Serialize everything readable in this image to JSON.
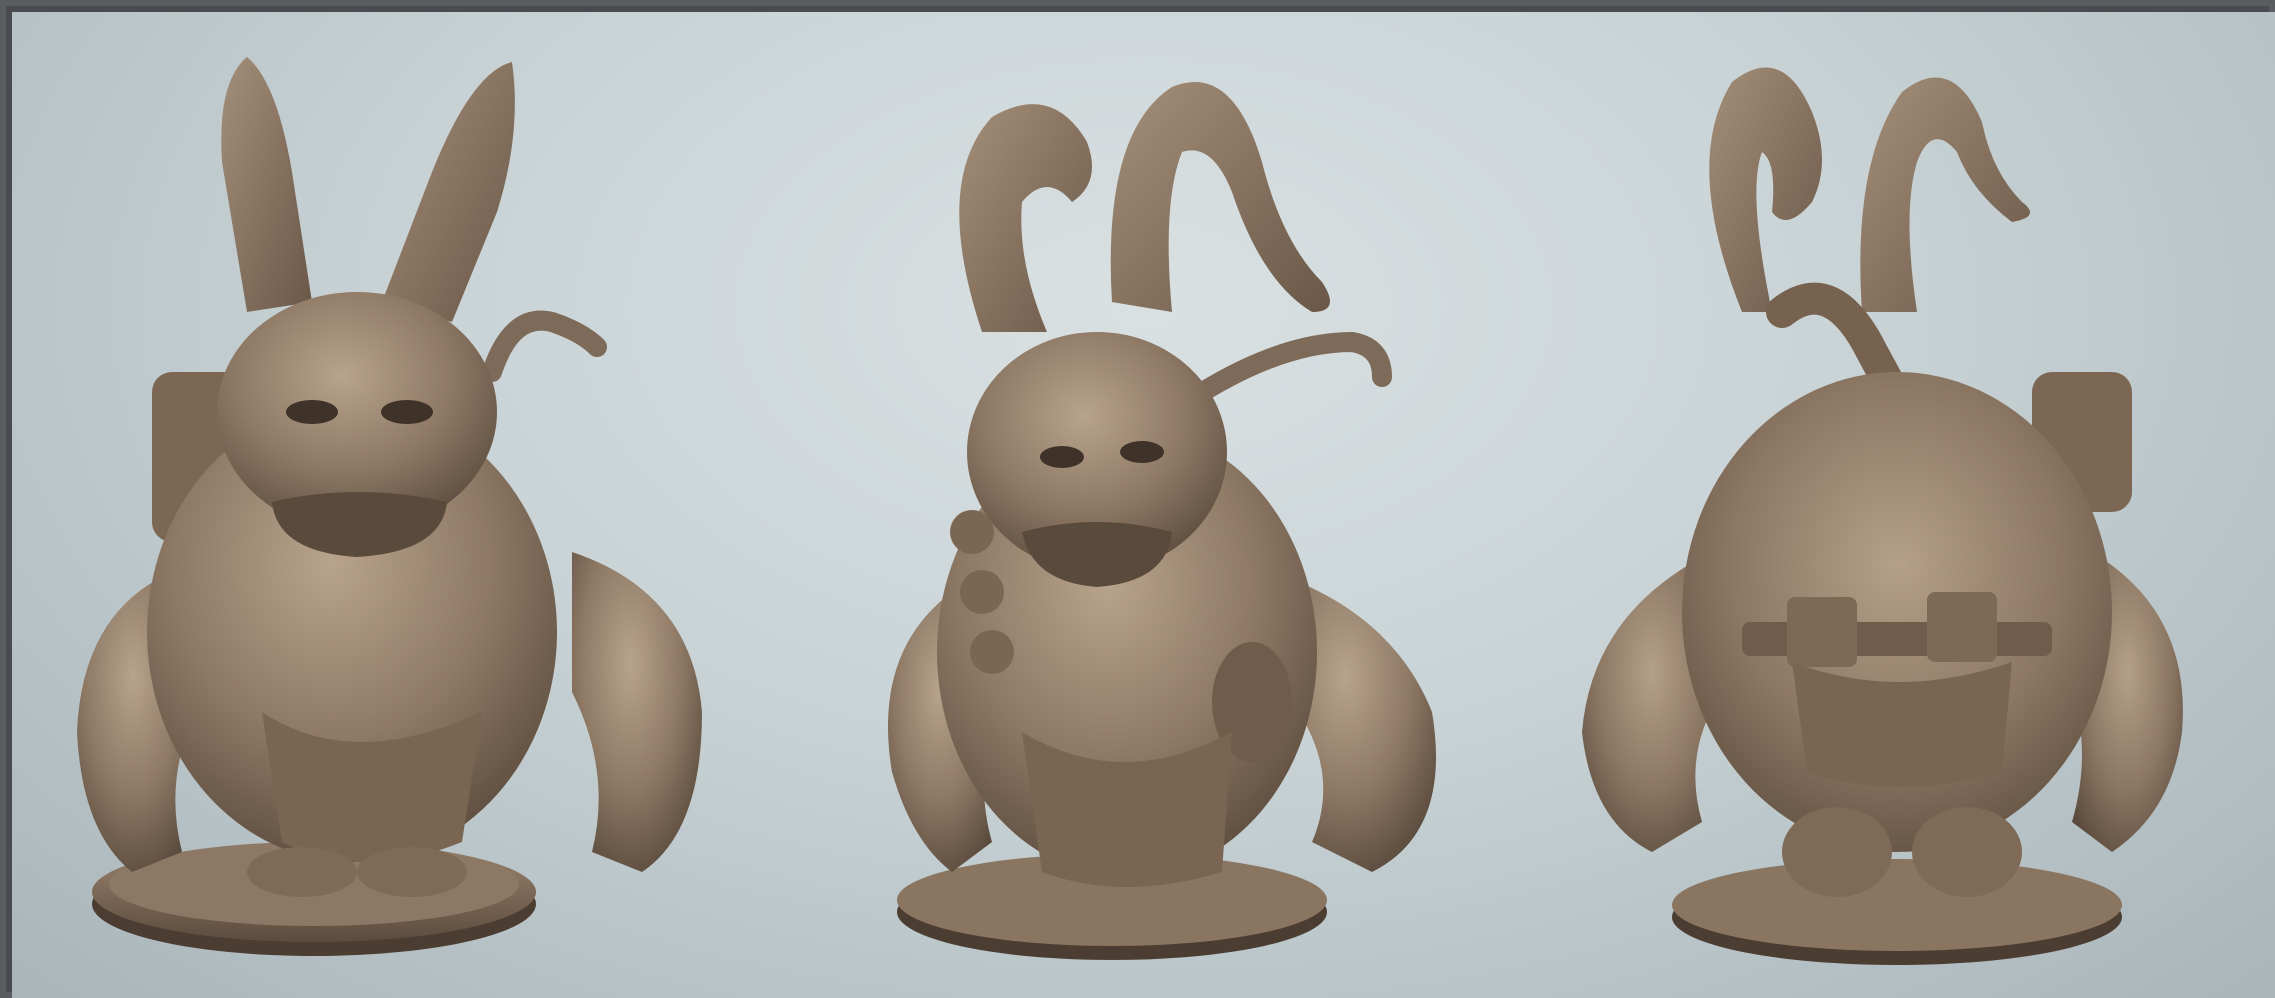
{
  "scene": {
    "description_free": true,
    "palette": {
      "background_top": "#d9e0e2",
      "background_bottom": "#a9b5b9",
      "border": "#5a5c5f",
      "clay": "#8b7663",
      "clay_light": "#b09a84",
      "clay_dark": "#5b4a3c",
      "shadow": "#3e3229"
    },
    "views": [
      {
        "view": "front",
        "horns": "straight"
      },
      {
        "view": "three-quarter",
        "horns": "curled"
      },
      {
        "view": "back",
        "horns": "curled"
      }
    ]
  }
}
